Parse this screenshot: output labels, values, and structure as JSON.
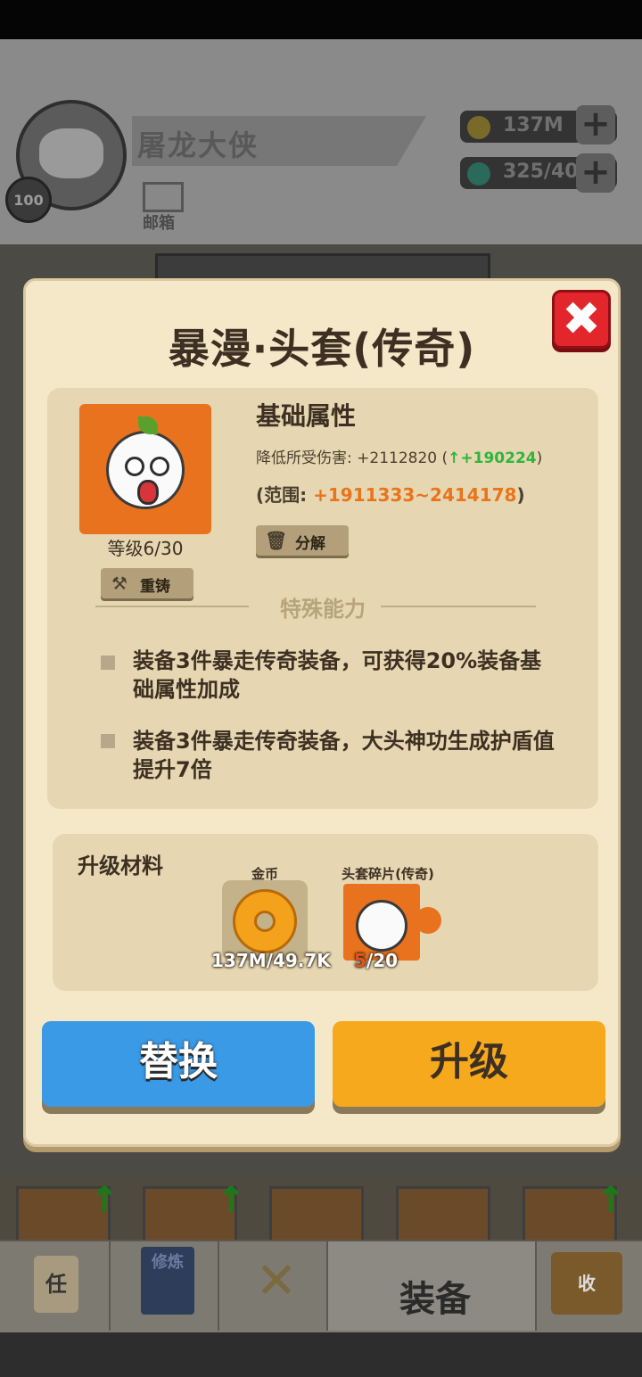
{
  "background": {
    "player": {
      "name": "屠龙大侠",
      "level": "100",
      "mail_label": "邮箱"
    },
    "resources": [
      {
        "icon": "gold-coin-icon",
        "value": "137M"
      },
      {
        "icon": "gem-icon",
        "value": "325/40"
      }
    ],
    "nav": {
      "active_label": "装备",
      "items": [
        {
          "icon": "task-scroll-icon",
          "text": "任"
        },
        {
          "icon": "cultivation-book-icon",
          "text": "修炼"
        },
        {
          "icon": "crossed-swords-icon",
          "text": ""
        },
        {
          "icon": "equipment-icon",
          "text": "装备"
        },
        {
          "icon": "collection-hut-icon",
          "text": "收"
        }
      ]
    }
  },
  "modal": {
    "title": "暴漫·头套(传奇)",
    "close_icon": "close-x-icon",
    "item": {
      "icon": "rage-comic-hood-icon",
      "level_text": "等级6/30",
      "recast_label": "重铸",
      "decompose_label": "分解"
    },
    "base_attr": {
      "heading": "基础属性",
      "stat_name": "降低所受伤害:",
      "stat_value": "+2112820",
      "stat_delta": "+190224",
      "range_label": "(范围: ",
      "range_value": "+1911333~2414178",
      "range_close": ")"
    },
    "special": {
      "heading": "特殊能力",
      "abilities": [
        "装备3件暴走传奇装备，可获得20%装备基础属性加成",
        "装备3件暴走传奇装备，大头神功生成护盾值提升7倍"
      ]
    },
    "materials": {
      "heading": "升级材料",
      "items": [
        {
          "label": "金币",
          "count": "137M/49.7K",
          "icon": "gold-coin-icon"
        },
        {
          "label": "头套碎片(传奇)",
          "have": "5",
          "need": "/20",
          "icon": "hood-fragment-icon"
        }
      ]
    },
    "buttons": {
      "replace": "替换",
      "upgrade": "升级"
    },
    "colors": {
      "panel": "#f5e8c9",
      "accent_green": "#2fb53b",
      "accent_orange": "#e8741b",
      "replace_btn": "#3a9ae6",
      "upgrade_btn": "#f6a91c",
      "close_btn": "#e2262b"
    }
  }
}
